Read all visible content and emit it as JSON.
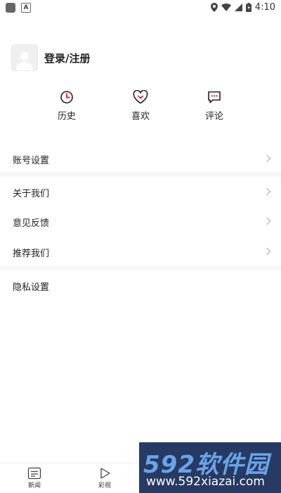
{
  "status_bar": {
    "time": "4:10"
  },
  "profile": {
    "login_label": "登录/注册"
  },
  "quick_actions": [
    {
      "label": "历史",
      "icon": "clock-icon"
    },
    {
      "label": "喜欢",
      "icon": "heart-icon"
    },
    {
      "label": "评论",
      "icon": "comment-icon"
    }
  ],
  "menu": {
    "account_settings": "账号设置",
    "about_us": "关于我们",
    "feedback": "意见反馈",
    "recommend_us": "推荐我们",
    "privacy_settings": "隐私设置"
  },
  "bottom_nav": {
    "news": "新闻",
    "video": "彩视"
  },
  "watermark": {
    "brand": "592软件园",
    "url": "www.592xiazai.com"
  },
  "colors": {
    "accent_red": "#e02020",
    "watermark_bg": "#263a63",
    "watermark_blue": "#6aa4e8"
  }
}
